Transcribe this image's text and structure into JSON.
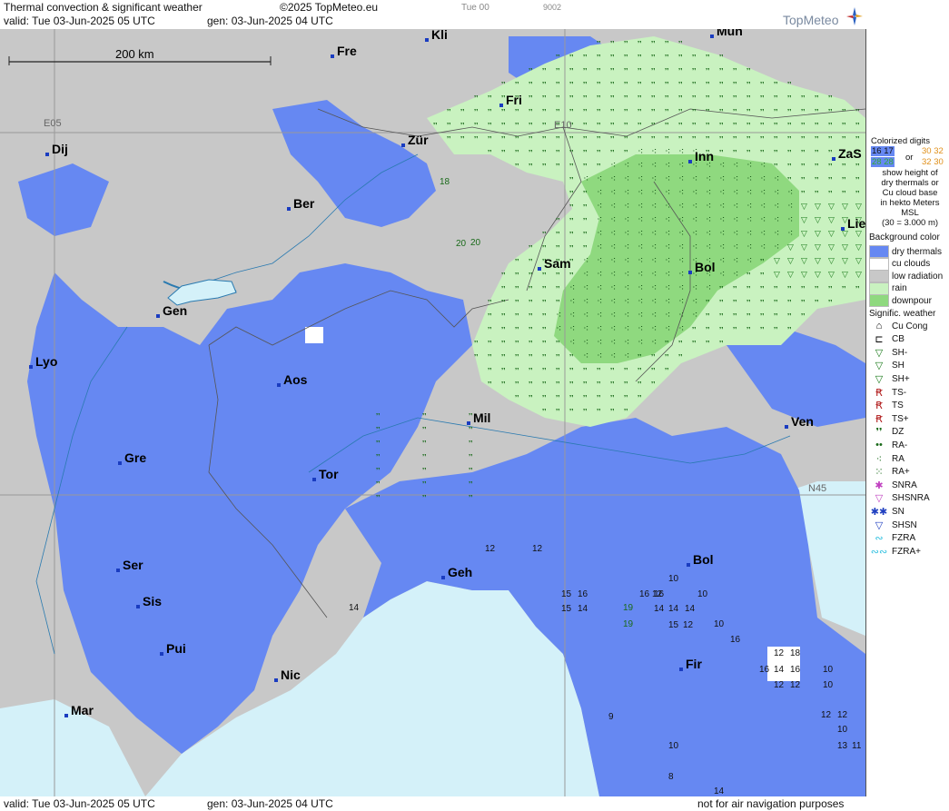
{
  "header": {
    "title": "Thermal convection & significant weather",
    "copyright": "©2025 TopMeteo.eu",
    "tab_time": "Tue 00",
    "code": "9002",
    "valid": "valid:  Tue   03-Jun-2025   05 UTC",
    "gen": "gen:  03-Jun-2025  04 UTC",
    "logo": "TopMeteo"
  },
  "map": {
    "scale": "200 km",
    "grid_labels": [
      "E05",
      "E10",
      "N45"
    ],
    "cities": [
      "Kli",
      "Mun",
      "Fre",
      "Fri",
      "Dij",
      "Zür",
      "Inn",
      "ZaS",
      "Ber",
      "Lie",
      "Sam",
      "Bol",
      "Gen",
      "Lyo",
      "Aos",
      "Mil",
      "Ven",
      "Gre",
      "Tor",
      "Ser",
      "Geh",
      "Bol",
      "Sis",
      "Pui",
      "Fir",
      "Nic",
      "Mar"
    ],
    "heights_green": [
      "18",
      "20",
      "20",
      "19",
      "19"
    ],
    "heights_black": [
      "12",
      "12",
      "15",
      "16",
      "15",
      "14",
      "16",
      "14",
      "16",
      "14",
      "14",
      "12",
      "15",
      "12",
      "10",
      "10",
      "14",
      "16",
      "10",
      "12",
      "18",
      "16",
      "14",
      "16",
      "12",
      "12",
      "10",
      "10",
      "12",
      "12",
      "10",
      "13",
      "11",
      "9",
      "10",
      "8",
      "14"
    ]
  },
  "legend": {
    "colorized_title": [
      "Colorized digits",
      "show height of",
      "dry thermals or",
      "Cu cloud base",
      "in hekto Meters",
      "MSL",
      "(30 = 3.000 m)"
    ],
    "sample_a": "16 17",
    "sample_b": "28 28",
    "or": "or",
    "sample_c": "30 32",
    "sample_d": "32 30",
    "background_title": "Background color",
    "backgrounds": [
      {
        "label": "dry thermals",
        "color": "#6688f2"
      },
      {
        "label": "cu clouds",
        "color": "#ffffff"
      },
      {
        "label": "low radiation",
        "color": "#c8c8c8"
      },
      {
        "label": "rain",
        "color": "#c9f2c0"
      },
      {
        "label": "downpour",
        "color": "#8fd97f"
      }
    ],
    "weather_title": "Signific. weather",
    "weather": [
      {
        "label": "Cu Cong",
        "icon": "cu-cong-icon",
        "sym": "⌂",
        "color": "#000"
      },
      {
        "label": "CB",
        "icon": "cb-icon",
        "sym": "⊏",
        "color": "#000"
      },
      {
        "label": "SH-",
        "icon": "shower-light-icon",
        "sym": "▽",
        "color": "#1a7a1a"
      },
      {
        "label": "SH",
        "icon": "shower-icon",
        "sym": "▽",
        "color": "#1a7a1a"
      },
      {
        "label": "SH+",
        "icon": "shower-heavy-icon",
        "sym": "▽",
        "color": "#1a7a1a"
      },
      {
        "label": "TS-",
        "icon": "thunderstorm-light-icon",
        "sym": "Ꞧ",
        "color": "#b01818"
      },
      {
        "label": "TS",
        "icon": "thunderstorm-icon",
        "sym": "Ꞧ",
        "color": "#b01818"
      },
      {
        "label": "TS+",
        "icon": "thunderstorm-heavy-icon",
        "sym": "Ꞧ",
        "color": "#b01818"
      },
      {
        "label": "DZ",
        "icon": "drizzle-icon",
        "sym": "❜❜",
        "color": "#1a6a1a"
      },
      {
        "label": "RA-",
        "icon": "rain-light-icon",
        "sym": "••",
        "color": "#1a6a1a"
      },
      {
        "label": "RA",
        "icon": "rain-icon",
        "sym": "⁖",
        "color": "#1a6a1a"
      },
      {
        "label": "RA+",
        "icon": "rain-heavy-icon",
        "sym": "⁙",
        "color": "#1a6a1a"
      },
      {
        "label": "SNRA",
        "icon": "snow-rain-icon",
        "sym": "✱",
        "color": "#c040c0"
      },
      {
        "label": "SHSNRA",
        "icon": "snow-rain-shower-icon",
        "sym": "▽",
        "color": "#c040c0"
      },
      {
        "label": "SN",
        "icon": "snow-icon",
        "sym": "✱✱",
        "color": "#2040c0"
      },
      {
        "label": "SHSN",
        "icon": "snow-shower-icon",
        "sym": "▽",
        "color": "#2040c0"
      },
      {
        "label": "FZRA",
        "icon": "freezing-rain-icon",
        "sym": "∾",
        "color": "#30c0e0"
      },
      {
        "label": "FZRA+",
        "icon": "freezing-rain-heavy-icon",
        "sym": "∾∾",
        "color": "#30c0e0"
      }
    ]
  },
  "footer": {
    "valid": "valid:  Tue   03-Jun-2025   05 UTC",
    "gen": "gen:  03-Jun-2025  04 UTC",
    "note": "not for air navigation purposes"
  },
  "colors": {
    "dry": "#6688f2",
    "low": "#c8c8c8",
    "rain": "#c9f2c0",
    "downpour": "#8fd97f",
    "sea": "#d4f1f9"
  }
}
